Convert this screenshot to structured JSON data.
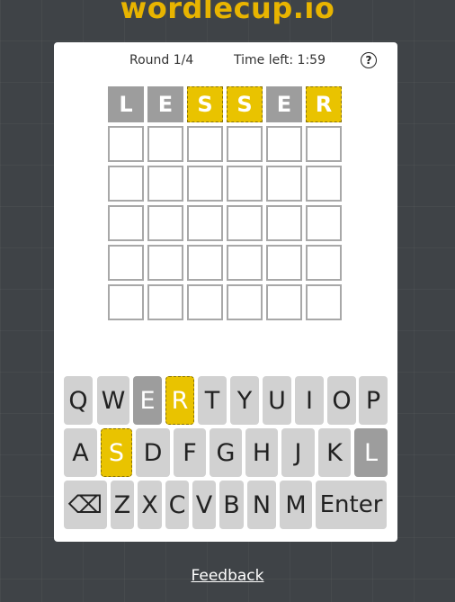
{
  "site": {
    "logo": "wordlecup.io",
    "feedback_label": "Feedback"
  },
  "header": {
    "round": "Round 1/4",
    "time_left": "Time left: 1:59",
    "help_label": "?"
  },
  "board": {
    "rows": [
      [
        {
          "letter": "L",
          "state": "absent"
        },
        {
          "letter": "E",
          "state": "absent"
        },
        {
          "letter": "S",
          "state": "present"
        },
        {
          "letter": "S",
          "state": "present"
        },
        {
          "letter": "E",
          "state": "absent"
        },
        {
          "letter": "R",
          "state": "present"
        }
      ],
      [
        {
          "letter": "",
          "state": "empty"
        },
        {
          "letter": "",
          "state": "empty"
        },
        {
          "letter": "",
          "state": "empty"
        },
        {
          "letter": "",
          "state": "empty"
        },
        {
          "letter": "",
          "state": "empty"
        },
        {
          "letter": "",
          "state": "empty"
        }
      ],
      [
        {
          "letter": "",
          "state": "empty"
        },
        {
          "letter": "",
          "state": "empty"
        },
        {
          "letter": "",
          "state": "empty"
        },
        {
          "letter": "",
          "state": "empty"
        },
        {
          "letter": "",
          "state": "empty"
        },
        {
          "letter": "",
          "state": "empty"
        }
      ],
      [
        {
          "letter": "",
          "state": "empty"
        },
        {
          "letter": "",
          "state": "empty"
        },
        {
          "letter": "",
          "state": "empty"
        },
        {
          "letter": "",
          "state": "empty"
        },
        {
          "letter": "",
          "state": "empty"
        },
        {
          "letter": "",
          "state": "empty"
        }
      ],
      [
        {
          "letter": "",
          "state": "empty"
        },
        {
          "letter": "",
          "state": "empty"
        },
        {
          "letter": "",
          "state": "empty"
        },
        {
          "letter": "",
          "state": "empty"
        },
        {
          "letter": "",
          "state": "empty"
        },
        {
          "letter": "",
          "state": "empty"
        }
      ],
      [
        {
          "letter": "",
          "state": "empty"
        },
        {
          "letter": "",
          "state": "empty"
        },
        {
          "letter": "",
          "state": "empty"
        },
        {
          "letter": "",
          "state": "empty"
        },
        {
          "letter": "",
          "state": "empty"
        },
        {
          "letter": "",
          "state": "empty"
        }
      ]
    ]
  },
  "keyboard": {
    "rows": [
      [
        {
          "label": "Q",
          "state": "unused"
        },
        {
          "label": "W",
          "state": "unused"
        },
        {
          "label": "E",
          "state": "absent"
        },
        {
          "label": "R",
          "state": "present"
        },
        {
          "label": "T",
          "state": "unused"
        },
        {
          "label": "Y",
          "state": "unused"
        },
        {
          "label": "U",
          "state": "unused"
        },
        {
          "label": "I",
          "state": "unused"
        },
        {
          "label": "O",
          "state": "unused"
        },
        {
          "label": "P",
          "state": "unused"
        }
      ],
      [
        {
          "label": "A",
          "state": "unused"
        },
        {
          "label": "S",
          "state": "present"
        },
        {
          "label": "D",
          "state": "unused"
        },
        {
          "label": "F",
          "state": "unused"
        },
        {
          "label": "G",
          "state": "unused"
        },
        {
          "label": "H",
          "state": "unused"
        },
        {
          "label": "J",
          "state": "unused"
        },
        {
          "label": "K",
          "state": "unused"
        },
        {
          "label": "L",
          "state": "absent"
        }
      ],
      [
        {
          "label": "⌫",
          "state": "unused",
          "icon": "backspace-icon"
        },
        {
          "label": "Z",
          "state": "unused"
        },
        {
          "label": "X",
          "state": "unused"
        },
        {
          "label": "C",
          "state": "unused"
        },
        {
          "label": "V",
          "state": "unused"
        },
        {
          "label": "B",
          "state": "unused"
        },
        {
          "label": "N",
          "state": "unused"
        },
        {
          "label": "M",
          "state": "unused"
        },
        {
          "label": "Enter",
          "state": "unused"
        }
      ]
    ]
  },
  "colors": {
    "present": "#e9c300",
    "absent": "#9d9d9d",
    "key": "#d1d1d1",
    "logo": "#e8b400"
  }
}
